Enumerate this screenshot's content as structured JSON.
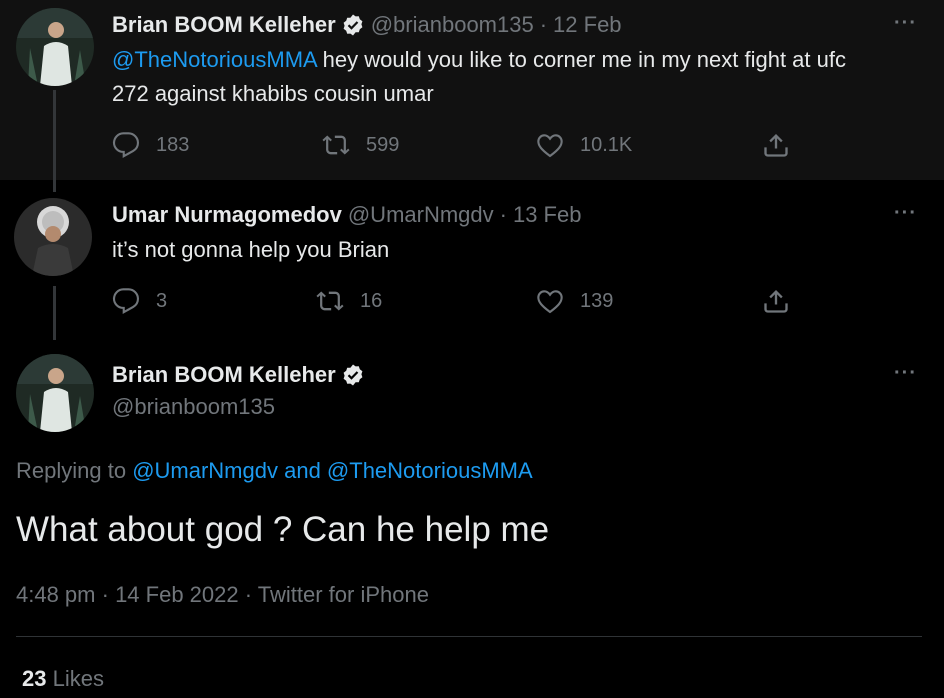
{
  "tweet1": {
    "name": "Brian BOOM Kelleher",
    "handle": "@brianboom135",
    "sep": "·",
    "date": "12 Feb",
    "mention": "@TheNotoriousMMA",
    "text_line1_rest": " hey would you like to corner me in my next fight at ufc",
    "text_line2": "272 against khabibs cousin umar",
    "reply_count": "183",
    "retweet_count": "599",
    "like_count": "10.1K",
    "more": "···"
  },
  "tweet2": {
    "name": "Umar Nurmagomedov",
    "handle": "@UmarNmgdv",
    "sep": "·",
    "date": "13 Feb",
    "text": "it’s not gonna help you Brian",
    "reply_count": "3",
    "retweet_count": "16",
    "like_count": "139",
    "more": "···"
  },
  "main": {
    "name": "Brian BOOM Kelleher",
    "handle": "@brianboom135",
    "replying_prefix": "Replying to ",
    "replying_to_1": "@UmarNmgdv",
    "replying_and": " and ",
    "replying_to_2": "@TheNotoriousMMA",
    "text": "What about god ? Can he help me",
    "time": "4:48 pm",
    "sep1": " · ",
    "date": "14 Feb 2022",
    "sep2": " · ",
    "source": "Twitter for iPhone",
    "likes_count": "23",
    "likes_label": "Likes",
    "more": "···"
  },
  "colors": {
    "accent": "#1d9bf0",
    "muted": "#71767b",
    "text": "#e7e9ea",
    "highlight_bg": "#111111"
  },
  "icons": [
    "reply-icon",
    "retweet-icon",
    "like-icon",
    "share-icon",
    "verified-icon",
    "more-icon"
  ]
}
